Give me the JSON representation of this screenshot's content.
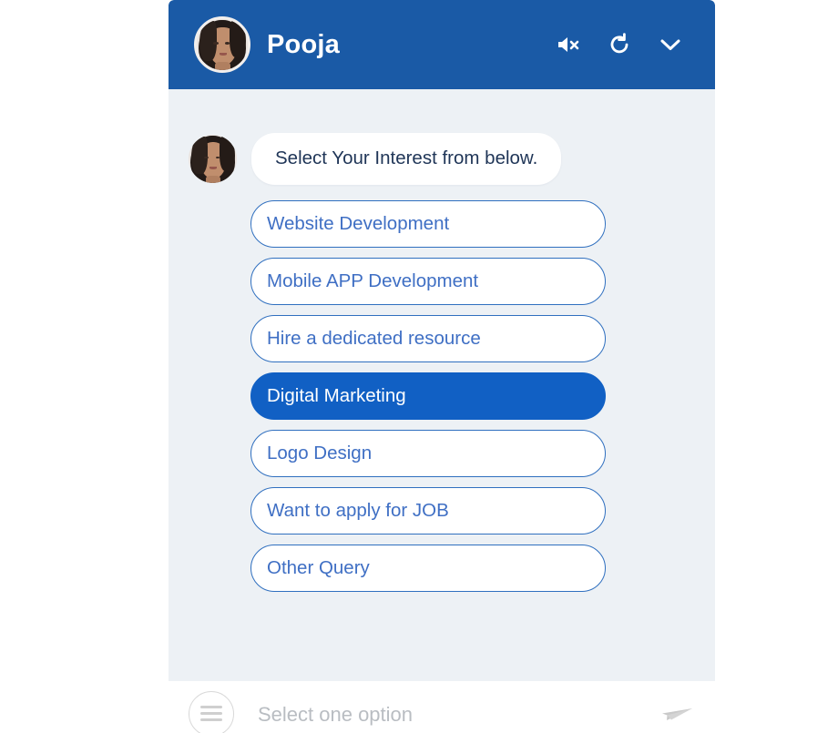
{
  "header": {
    "title": "Pooja",
    "avatar_alt": "agent-avatar",
    "actions": [
      {
        "icon": "mute-icon",
        "label": "Mute"
      },
      {
        "icon": "refresh-icon",
        "label": "Restart"
      },
      {
        "icon": "chevron-down-icon",
        "label": "Minimize"
      }
    ]
  },
  "conversation": {
    "message": {
      "text": "Select Your Interest from below.",
      "avatar_alt": "bot-avatar"
    },
    "options": [
      {
        "label": "Website Development",
        "selected": false
      },
      {
        "label": "Mobile APP Development",
        "selected": false
      },
      {
        "label": "Hire a dedicated resource",
        "selected": false
      },
      {
        "label": "Digital Marketing",
        "selected": true
      },
      {
        "label": "Logo Design",
        "selected": false
      },
      {
        "label": "Want to apply for JOB",
        "selected": false
      },
      {
        "label": "Other Query",
        "selected": false
      }
    ]
  },
  "composer": {
    "placeholder": "Select one option",
    "value": "",
    "menu_icon": "hamburger-menu-icon",
    "send_icon": "send-icon"
  },
  "colors": {
    "header_blue": "#1a5aa6",
    "selected_blue": "#1160c4",
    "option_border": "#2f6fbf",
    "option_text": "#3f6fc4",
    "chat_background": "#edf1f5",
    "message_text": "#1f3557",
    "placeholder_gray": "#b9bdc2"
  }
}
